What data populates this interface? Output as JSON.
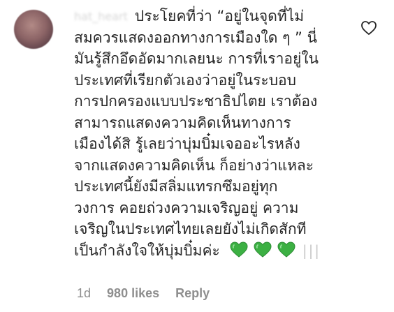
{
  "comment": {
    "username": "hat_heart",
    "lines": [
      "ประโยคที่ว่า “อยู่ในจุดที่ไม่",
      "สมควรแสดงออกทางการเมืองใด ๆ ” นี่",
      "มันรู้สึกอึดอัดมากเลยนะ การที่เราอยู่ใน",
      "ประเทศที่เรียกตัวเองว่าอยู่ในระบอบ",
      "การปกครองแบบประชาธิปไตย เราต้อง",
      "สามารถแสดงความคิดเห็นทางการ",
      "เมืองได้สิ รู้เลยว่าบุ่มบิ๋มเจออะไรหลัง",
      "จากแสดงความคิดเห็น ก็อย่างว่าแหละ",
      "ประเทศนี้ยังมีสลิ่มแทรกซึมอยู่ทุก",
      "วงการ คอยถ่วงความเจริญอยู่ ความ",
      "เจริญในประเทศไทยเลยยังไม่เกิดสักที",
      "เป็นกำลังใจให้บุ่มบิ๋มค่ะ"
    ],
    "trailing_emoji": [
      "green-heart",
      "green-heart",
      "green-heart"
    ],
    "trailing_mark": "|||",
    "time": "1d",
    "likes": "980 likes",
    "reply_label": "Reply",
    "heart_color": "#3cb043",
    "like_icon": "heart-outline-icon"
  }
}
